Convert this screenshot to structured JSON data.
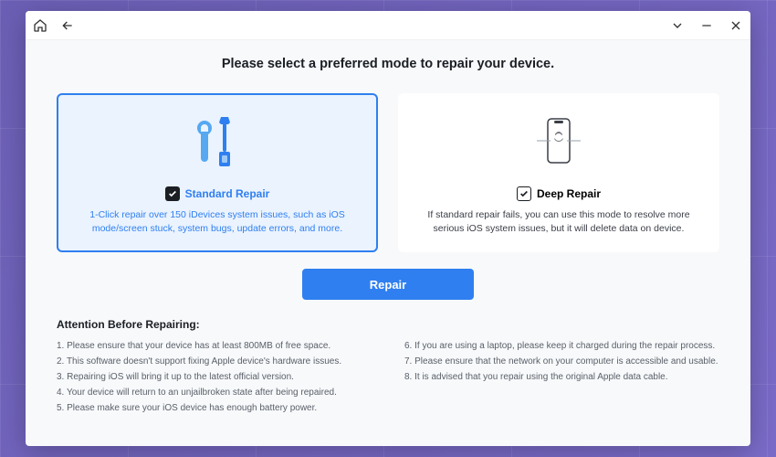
{
  "page_title": "Please select a preferred mode to repair your device.",
  "modes": {
    "standard": {
      "title": "Standard Repair",
      "desc": "1-Click repair over 150 iDevices system issues, such as iOS mode/screen stuck, system bugs, update errors, and more."
    },
    "deep": {
      "title": "Deep Repair",
      "desc": "If standard repair fails, you can use this mode to resolve more serious iOS system issues, but it will delete data on device."
    }
  },
  "repair_button": "Repair",
  "attention": {
    "heading": "Attention Before Repairing:",
    "left": [
      "1. Please ensure that your device has at least 800MB of free space.",
      "2. This software doesn't support fixing Apple device's hardware issues.",
      "3. Repairing iOS will bring it up to the latest official version.",
      "4. Your device will return to an unjailbroken state after being repaired.",
      "5. Please make sure your iOS device has enough battery power."
    ],
    "right": [
      "6. If you are using a laptop, please keep it charged during the repair process.",
      "7. Please ensure that the network on your computer is accessible and usable.",
      "8. It is advised that you repair using the original Apple data cable."
    ]
  }
}
